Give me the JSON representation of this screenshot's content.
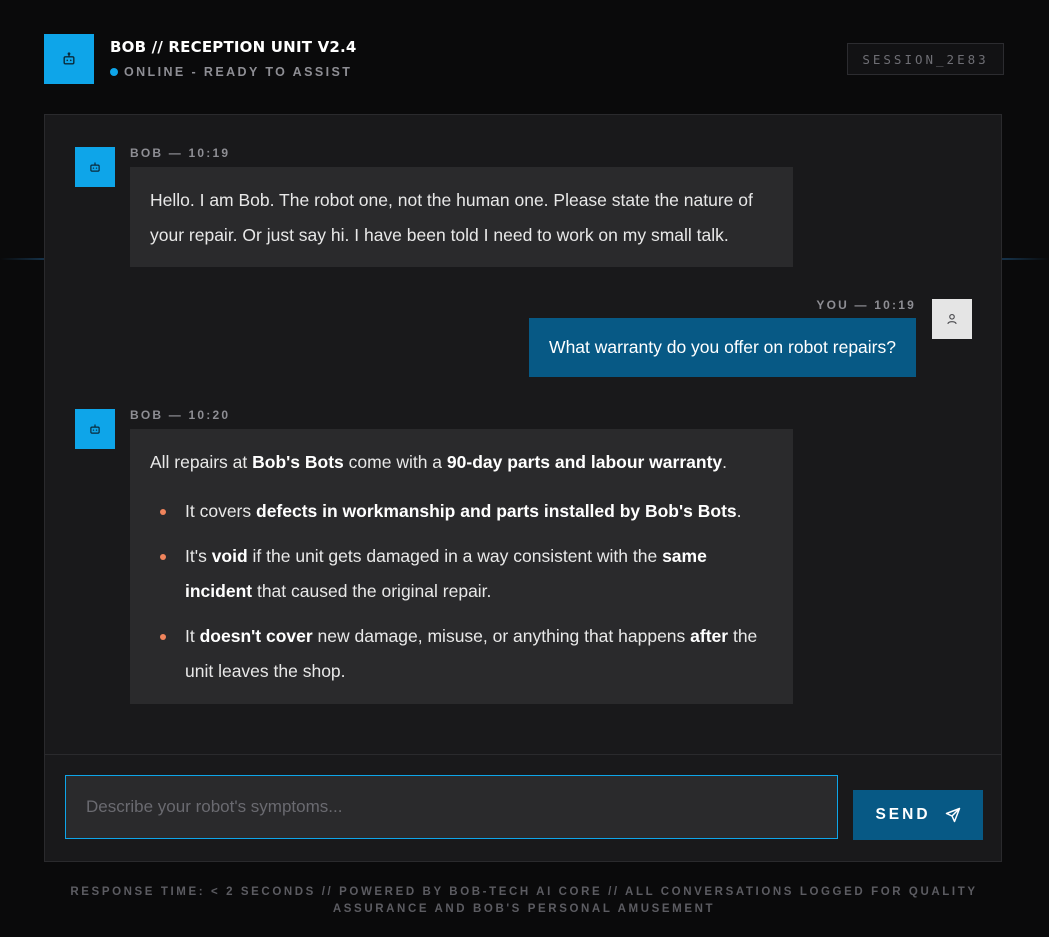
{
  "header": {
    "title": "BOB // RECEPTION UNIT V2.4",
    "status": "ONLINE - READY TO ASSIST",
    "session_id": "SESSION_2E83",
    "logo_icon": "robot-icon"
  },
  "colors": {
    "accent": "#0ea5e9",
    "user_bubble": "#075985",
    "bullet": "#f0845c",
    "background": "#0a0a0b",
    "panel": "#19191b"
  },
  "messages": [
    {
      "sender": "bot",
      "meta": "BOB — 10:19",
      "text": "Hello. I am Bob. The robot one, not the human one. Please state the nature of your repair. Or just say hi. I have been told I need to work on my small talk."
    },
    {
      "sender": "user",
      "meta": "YOU — 10:19",
      "text": "What warranty do you offer on robot repairs?"
    },
    {
      "sender": "bot",
      "meta": "BOB — 10:20",
      "intro": {
        "t1": "All repairs at ",
        "b1": "Bob's Bots",
        "t2": " come with a ",
        "b2": "90-day parts and labour warranty",
        "t3": "."
      },
      "bullets": [
        {
          "t1": "It covers ",
          "b1": "defects in workmanship and parts installed by Bob's Bots",
          "t2": "."
        },
        {
          "t1": "It's ",
          "b1": "void",
          "t2": " if the unit gets damaged in a way consistent with the ",
          "b2": "same incident",
          "t3": " that caused the original repair."
        },
        {
          "t1": "It ",
          "b1": "doesn't cover",
          "t2": " new damage, misuse, or anything that happens ",
          "b2": "after",
          "t3": " the unit leaves the shop."
        }
      ]
    }
  ],
  "composer": {
    "placeholder": "Describe your robot's symptoms...",
    "value": "",
    "send_label": "SEND",
    "send_icon": "paper-plane-icon"
  },
  "footer": {
    "text": "RESPONSE TIME: < 2 SECONDS // POWERED BY BOB-TECH AI CORE // ALL CONVERSATIONS LOGGED FOR QUALITY ASSURANCE AND BOB'S PERSONAL AMUSEMENT"
  }
}
